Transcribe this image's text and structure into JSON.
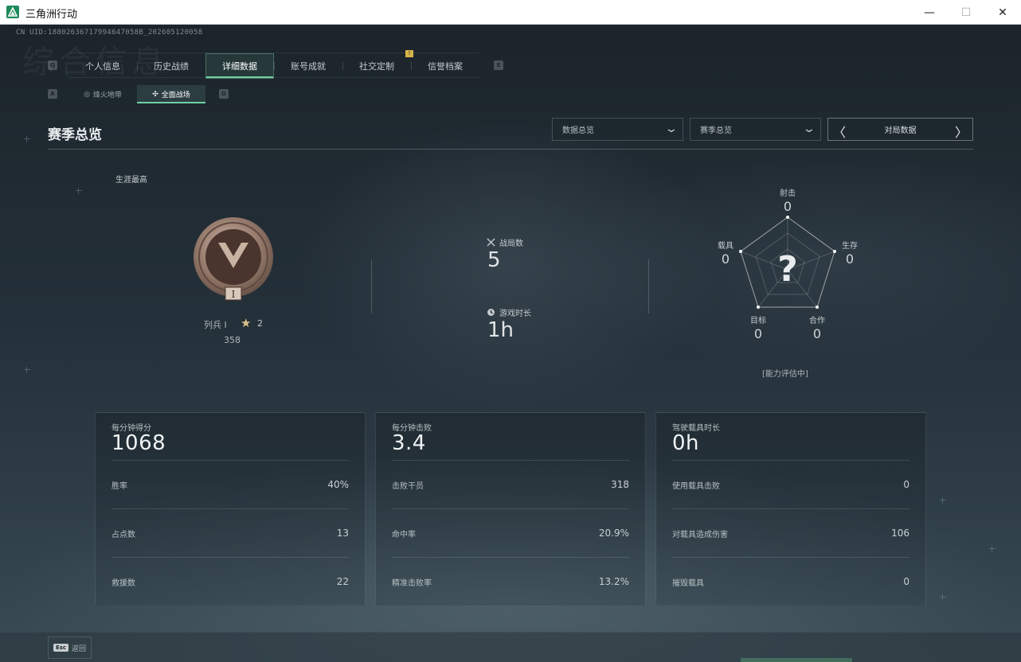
{
  "window": {
    "title": "三角洲行动",
    "minimize": "—",
    "maximize": "☐",
    "close": "✕"
  },
  "header": {
    "uid": "CN UID:18802636717994647058B_202605120058",
    "watermark": "综合信息"
  },
  "tabs": {
    "key_left": "Q",
    "key_right": "E",
    "items": [
      {
        "label": "个人信息"
      },
      {
        "label": "历史战绩"
      },
      {
        "label": "详细数据"
      },
      {
        "label": "账号成就"
      },
      {
        "label": "社交定制"
      },
      {
        "label": "信誉档案"
      }
    ],
    "badge": "!"
  },
  "subtabs": {
    "key_left": "A",
    "key_right": "D",
    "items": [
      {
        "label": "烽火地带",
        "icon": "◎"
      },
      {
        "label": "全面战场",
        "icon": "✣"
      }
    ]
  },
  "section": {
    "title": "赛季总览",
    "dropdown1": "数据总览",
    "dropdown2": "赛季总览",
    "selector": "对局数据",
    "chev": "⌄",
    "prev": "〈",
    "next": "〉"
  },
  "rank": {
    "career_label": "生涯最高",
    "name": "列兵 I",
    "star_icon": "★",
    "stars": "2",
    "points": "358",
    "numeral": "I"
  },
  "matches": {
    "count_label": "战局数",
    "count": "5",
    "time_label": "游戏时长",
    "time": "1h"
  },
  "radar": {
    "center": "?",
    "status": "[能力评估中]",
    "axes": [
      {
        "label": "射击",
        "value": "0"
      },
      {
        "label": "生存",
        "value": "0"
      },
      {
        "label": "合作",
        "value": "0"
      },
      {
        "label": "目标",
        "value": "0"
      },
      {
        "label": "载具",
        "value": "0"
      }
    ]
  },
  "cards": [
    {
      "head_label": "每分钟得分",
      "head_value": "1068",
      "rows": [
        {
          "label": "胜率",
          "value": "40%"
        },
        {
          "label": "占点数",
          "value": "13"
        },
        {
          "label": "救援数",
          "value": "22"
        }
      ]
    },
    {
      "head_label": "每分钟击败",
      "head_value": "3.4",
      "rows": [
        {
          "label": "击败干员",
          "value": "318"
        },
        {
          "label": "命中率",
          "value": "20.9%"
        },
        {
          "label": "精准击败率",
          "value": "13.2%"
        }
      ]
    },
    {
      "head_label": "驾驶载具时长",
      "head_value": "0h",
      "rows": [
        {
          "label": "使用载具击败",
          "value": "0"
        },
        {
          "label": "对载具造成伤害",
          "value": "106"
        },
        {
          "label": "摧毁载具",
          "value": "0"
        }
      ]
    }
  ],
  "footer": {
    "esc_key": "Esc",
    "esc_label": "返回"
  },
  "colors": {
    "accent": "#6fd1a7",
    "badge": "#d7b44a",
    "background": "#1d262c"
  }
}
